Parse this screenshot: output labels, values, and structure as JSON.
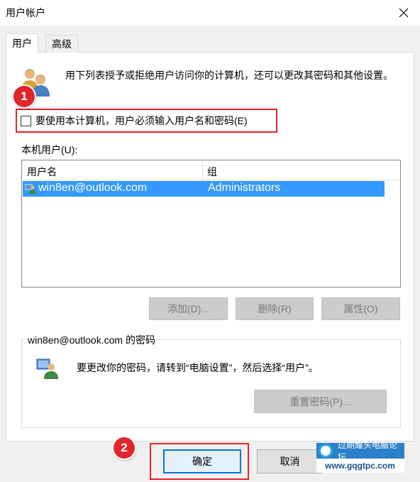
{
  "window": {
    "title": "用户帐户"
  },
  "tabs": [
    {
      "label": "用户",
      "active": true
    },
    {
      "label": "高级",
      "active": false
    }
  ],
  "description": "用下列表授予或拒绝用户访问你的计算机，还可以更改其密码和其他设置。",
  "require_login_checkbox": {
    "label": "要使用本计算机，用户必须输入用户名和密码(E)",
    "checked": false
  },
  "local_users_label": "本机用户(U):",
  "users_table": {
    "columns": [
      "用户名",
      "组"
    ],
    "rows": [
      {
        "username": "win8en@outlook.com",
        "group": "Administrators",
        "selected": true
      }
    ]
  },
  "user_buttons": {
    "add": "添加(D)...",
    "remove": "删除(R)",
    "properties": "属性(O)"
  },
  "password_group": {
    "title": "win8en@outlook.com 的密码",
    "text": "要更改你的密码，请转到“电脑设置”，然后选择“用户”。",
    "reset_button": "重置密码(P)..."
  },
  "dialog_buttons": {
    "ok": "确定",
    "cancel": "取消"
  },
  "annotations": {
    "badge1": "1",
    "badge2": "2",
    "color": "#e0262b"
  },
  "watermark": {
    "line1": "过期耀头电脑论坛",
    "line2": "www.gqgtpc.com"
  },
  "colors": {
    "selection": "#3399ff",
    "accent": "#0078d7"
  },
  "icons": {
    "close": "close-icon",
    "users": "users-icon",
    "user_row": "user-row-icon",
    "password_user": "user-icon"
  }
}
